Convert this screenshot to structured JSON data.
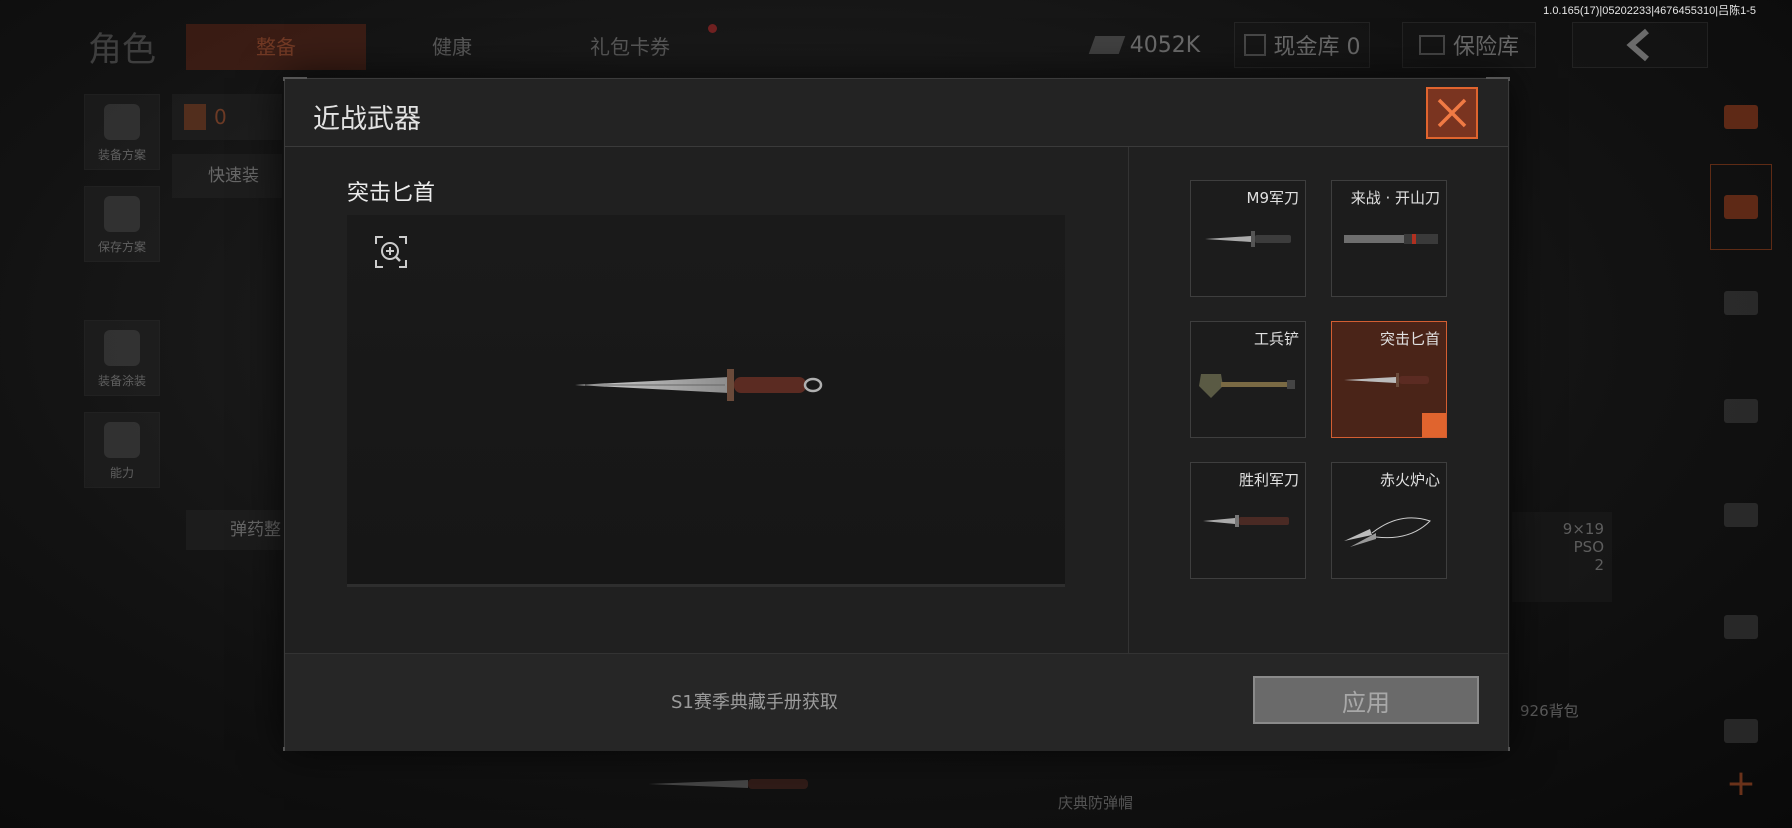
{
  "version": "1.0.165(17)|05202233|4676455310|吕陈1-5",
  "background": {
    "title": "角色",
    "tabs": [
      "整备",
      "健康",
      "礼包卡券"
    ],
    "currency": "4052K",
    "cash_vault": "现金库 0",
    "insurance_vault": "保险库",
    "left_sidebar": [
      "装备方案",
      "保存方案",
      "装备涂装",
      "能力"
    ],
    "count_value": "0",
    "quick_equip": "快速装",
    "ammo_sort": "弹药整",
    "ammo_label": "9×19\nPSO",
    "ammo_count": "2",
    "backpack_label": "926背包",
    "helmet_label": "庆典防弹帽"
  },
  "modal": {
    "title": "近战武器",
    "selected_item": "突击匕首",
    "weapons": [
      {
        "label": "M9军刀",
        "icon": "bayonet-icon",
        "selected": false
      },
      {
        "label": "来战 · 开山刀",
        "icon": "machete-icon",
        "selected": false
      },
      {
        "label": "工兵铲",
        "icon": "shovel-icon",
        "selected": false
      },
      {
        "label": "突击匕首",
        "icon": "dagger-icon",
        "selected": true
      },
      {
        "label": "胜利军刀",
        "icon": "saber-icon",
        "selected": false
      },
      {
        "label": "赤火炉心",
        "icon": "kunai-icon",
        "selected": false
      }
    ],
    "source_text": "S1赛季典藏手册获取",
    "apply_label": "应用"
  },
  "colors": {
    "accent": "#e0642e",
    "selected_bg": "#4a2418"
  }
}
